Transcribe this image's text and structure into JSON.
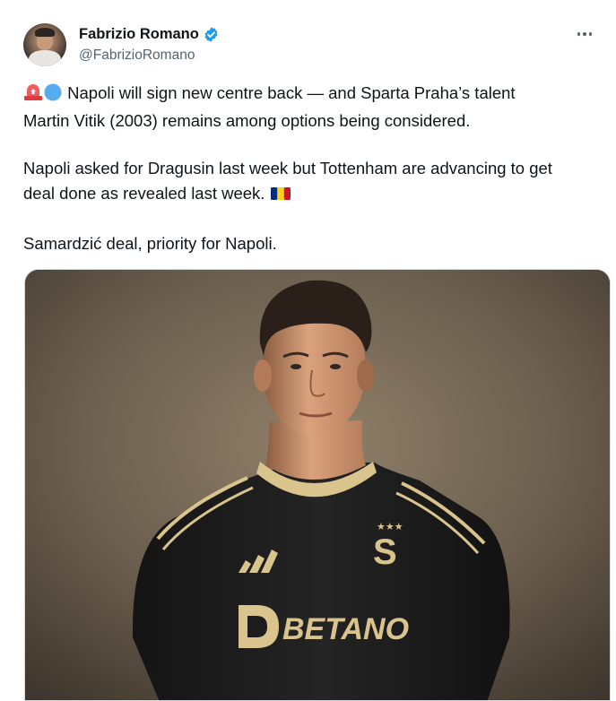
{
  "tweet": {
    "author": {
      "display_name": "Fabrizio Romano",
      "handle": "@FabrizioRomano",
      "verified": true,
      "avatar_icon": "profile-photo"
    },
    "more_icon": "more-options-icon",
    "paragraphs": [
      {
        "emojis": [
          "police-light-emoji",
          "blue-circle-emoji"
        ],
        "line1": "Napoli will sign new centre back — and Sparta Praha’s talent",
        "line2": "Martin Vitik (2003) remains among options being considered."
      },
      {
        "line1": "Napoli asked for Dragusin last week but Tottenham are advancing to get",
        "line2": "deal done as revealed last week.",
        "trailing_emoji": "romania-flag-emoji"
      },
      {
        "line1": "Samardzić deal, priority for Napoli."
      }
    ],
    "media": {
      "description_icon": "player-photo",
      "shirt_sponsor": "BETANO",
      "shirt_crest_letter": "S",
      "shirt_crest_stars": "★★★"
    }
  },
  "colors": {
    "text_primary": "#0f1419",
    "text_secondary": "#536471",
    "verified_blue": "#1d9bf0",
    "shirt_black": "#1c1c1e",
    "shirt_gold": "#d9c48d"
  }
}
